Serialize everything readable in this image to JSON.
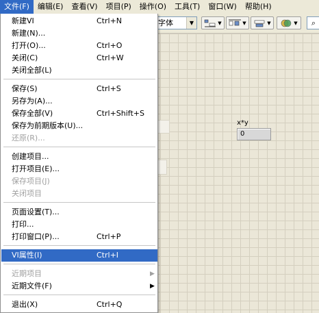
{
  "menubar": [
    {
      "label": "文件(F)",
      "active": true
    },
    {
      "label": "编辑(E)"
    },
    {
      "label": "查看(V)"
    },
    {
      "label": "项目(P)"
    },
    {
      "label": "操作(O)"
    },
    {
      "label": "工具(T)"
    },
    {
      "label": "窗口(W)"
    },
    {
      "label": "帮助(H)"
    }
  ],
  "toolbar": {
    "font_label": "字体"
  },
  "canvas": {
    "indicator_label": "x*y",
    "indicator_value": "0"
  },
  "menu": {
    "new_vi": {
      "label": "新建VI",
      "shortcut": "Ctrl+N"
    },
    "new": {
      "label": "新建(N)..."
    },
    "open": {
      "label": "打开(O)...",
      "shortcut": "Ctrl+O"
    },
    "close": {
      "label": "关闭(C)",
      "shortcut": "Ctrl+W"
    },
    "close_all": {
      "label": "关闭全部(L)"
    },
    "save": {
      "label": "保存(S)",
      "shortcut": "Ctrl+S"
    },
    "save_as": {
      "label": "另存为(A)..."
    },
    "save_all": {
      "label": "保存全部(V)",
      "shortcut": "Ctrl+Shift+S"
    },
    "save_prev": {
      "label": "保存为前期版本(U)..."
    },
    "revert": {
      "label": "还原(R)..."
    },
    "create_project": {
      "label": "创建项目..."
    },
    "open_project": {
      "label": "打开项目(E)..."
    },
    "save_project": {
      "label": "保存项目(J)"
    },
    "close_project": {
      "label": "关闭项目"
    },
    "page_setup": {
      "label": "页面设置(T)..."
    },
    "print": {
      "label": "打印..."
    },
    "print_window": {
      "label": "打印窗口(P)...",
      "shortcut": "Ctrl+P"
    },
    "vi_properties": {
      "label": "VI属性(I)",
      "shortcut": "Ctrl+I"
    },
    "recent_projects": {
      "label": "近期项目"
    },
    "recent_files": {
      "label": "近期文件(F)"
    },
    "exit": {
      "label": "退出(X)",
      "shortcut": "Ctrl+Q"
    }
  }
}
